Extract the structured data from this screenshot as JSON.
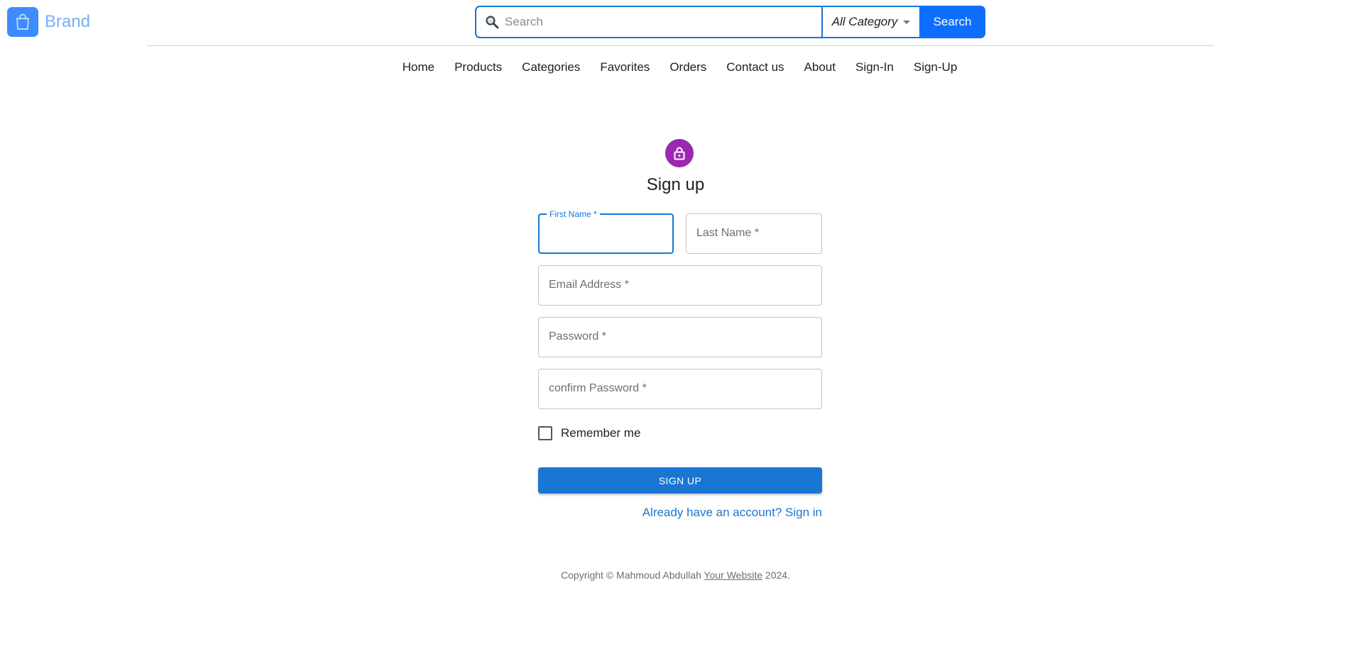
{
  "header": {
    "brand": "Brand",
    "search_placeholder": "Search",
    "category": "All Category",
    "search_button": "Search"
  },
  "nav": [
    "Home",
    "Products",
    "Categories",
    "Favorites",
    "Orders",
    "Contact us",
    "About",
    "Sign-In",
    "Sign-Up"
  ],
  "form": {
    "title": "Sign up",
    "first_name_label": "First Name *",
    "last_name_label": "Last Name *",
    "email_label": "Email Address *",
    "password_label": "Password *",
    "confirm_password_label": "confirm Password *",
    "remember_label": "Remember me",
    "submit": "Sign Up",
    "signin_link": "Already have an account? Sign in"
  },
  "footer": {
    "prefix": "Copyright © Mahmoud Abdullah ",
    "link": "Your Website",
    "suffix": " 2024."
  },
  "colors": {
    "primary": "#1976d2",
    "brand_blue": "#3d8bfd",
    "avatar_purple": "#9c27b0"
  }
}
